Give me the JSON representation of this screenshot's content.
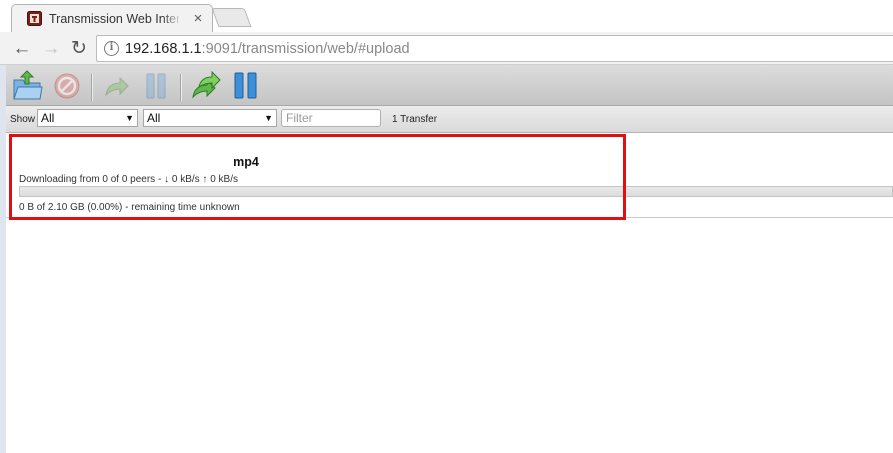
{
  "browser": {
    "tab_title": "Transmission Web Interface",
    "tab_close_glyph": "×",
    "back_glyph": "←",
    "forward_glyph": "→",
    "reload_glyph": "↻",
    "info_glyph": "i",
    "url_host": "192.168.1.1",
    "url_rest": ":9091/transmission/web/#upload"
  },
  "toolbar": {
    "buttons": [
      {
        "icon": "open-torrent-icon",
        "enabled": true
      },
      {
        "icon": "remove-icon",
        "enabled": false
      },
      {
        "icon": "resume-icon",
        "enabled": false
      },
      {
        "icon": "pause-icon",
        "enabled": false
      },
      {
        "icon": "resume-all-icon",
        "enabled": true
      },
      {
        "icon": "pause-all-icon",
        "enabled": true
      }
    ]
  },
  "filterbar": {
    "show_label": "Show",
    "status_filter": "All",
    "tracker_filter": "All",
    "filter_placeholder": "Filter",
    "transfer_count": "1 Transfer"
  },
  "torrents": [
    {
      "name": "mp4",
      "peers_text": "Downloading from 0 of 0 peers - ↓ 0 kB/s ↑ 0 kB/s",
      "progress_percent": 0,
      "status_text": "0 B of 2.10 GB (0.00%) - remaining time unknown"
    }
  ],
  "colors": {
    "highlight": "#e01010",
    "progress_fill": "#3b86d4"
  }
}
